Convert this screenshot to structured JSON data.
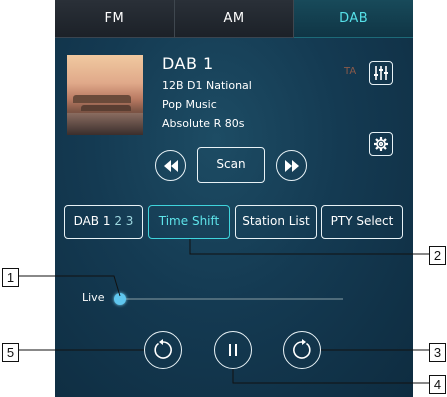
{
  "tabs": [
    {
      "label": "FM",
      "active": false
    },
    {
      "label": "AM",
      "active": false
    },
    {
      "label": "DAB",
      "active": true
    }
  ],
  "station": {
    "name": "DAB 1",
    "ensemble": "12B  D1 National",
    "genre": "Pop Music",
    "service": "Absolute R 80s"
  },
  "ta_label": "TA",
  "controls": {
    "scan_label": "Scan",
    "seek_back_icon": "seek-back-icon",
    "seek_forward_icon": "seek-forward-icon",
    "equalizer_icon": "equalizer-icon",
    "settings_icon": "gear-icon"
  },
  "modes": {
    "dab_prefix": "DAB ",
    "dab_1": "1",
    "dab_23": "2 3",
    "time_shift": "Time Shift",
    "station_list": "Station List",
    "pty_select": "PTY Select",
    "active": "Time Shift"
  },
  "timeshift": {
    "live_label": "Live",
    "position": 0
  },
  "playback": {
    "rewind_icon": "rewind-icon",
    "pause_icon": "pause-icon",
    "forward_icon": "forward-icon"
  },
  "callouts": [
    "1",
    "2",
    "3",
    "4",
    "5"
  ],
  "colors": {
    "accent": "#56e0e8",
    "background": "#143a52",
    "slider_knob": "#5fc6ee"
  }
}
